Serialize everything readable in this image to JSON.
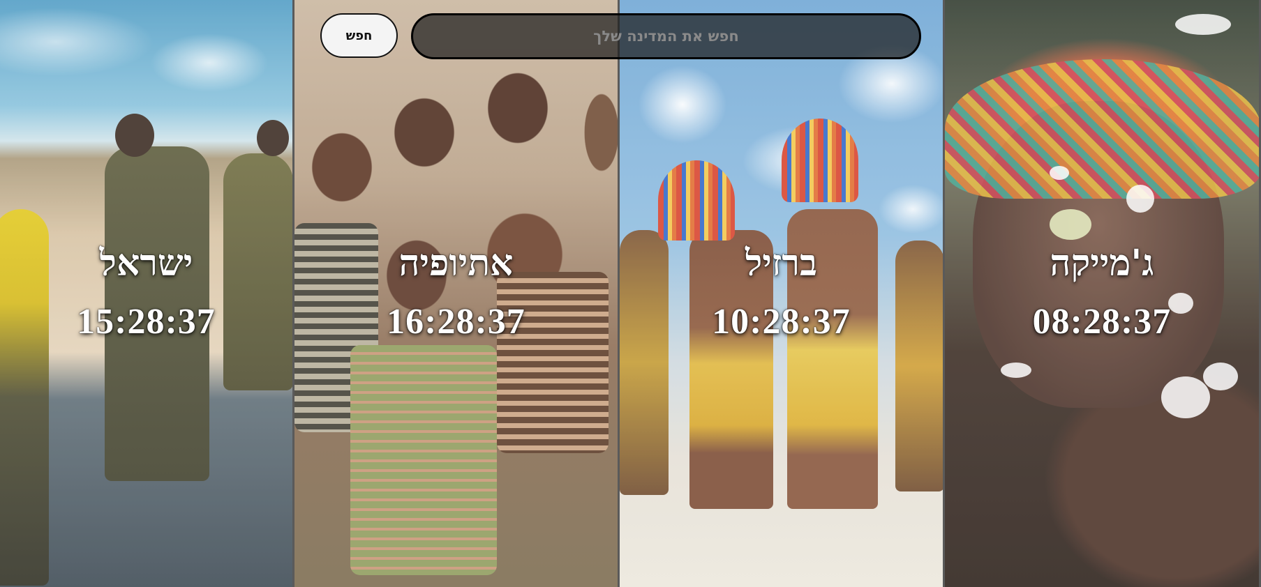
{
  "search": {
    "button_label": "חפש",
    "placeholder": "חפש את המדינה שלך"
  },
  "panels": [
    {
      "country": "ישראל",
      "time": "15:28:37"
    },
    {
      "country": "אתיופיה",
      "time": "16:28:37"
    },
    {
      "country": "ברזיל",
      "time": "10:28:37"
    },
    {
      "country": "ג'מייקה",
      "time": "08:28:37"
    }
  ]
}
